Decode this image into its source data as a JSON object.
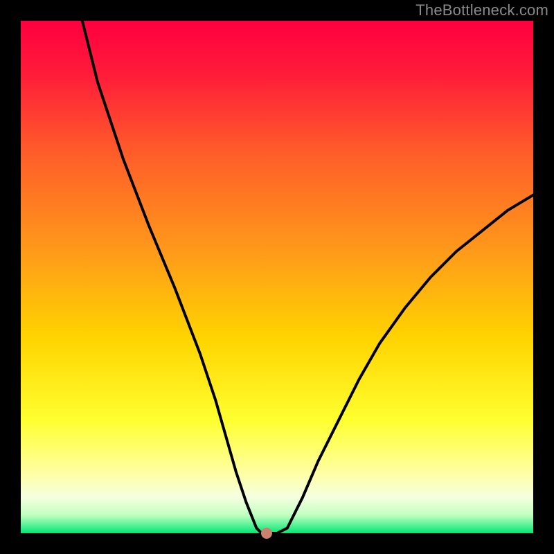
{
  "watermark": "TheBottleneck.com",
  "colors": {
    "frame_bg": "#000000",
    "watermark": "#8a8a8a",
    "curve": "#000000",
    "marker": "#cc8070",
    "gradient_stops": [
      {
        "offset": 0.0,
        "color": "#ff0040"
      },
      {
        "offset": 0.1,
        "color": "#ff1a3a"
      },
      {
        "offset": 0.25,
        "color": "#ff5a2a"
      },
      {
        "offset": 0.45,
        "color": "#ff9a1a"
      },
      {
        "offset": 0.62,
        "color": "#ffd400"
      },
      {
        "offset": 0.78,
        "color": "#ffff30"
      },
      {
        "offset": 0.88,
        "color": "#ffffa0"
      },
      {
        "offset": 0.93,
        "color": "#f5ffe0"
      },
      {
        "offset": 0.965,
        "color": "#c0ffc0"
      },
      {
        "offset": 1.0,
        "color": "#00e874"
      }
    ]
  },
  "chart_data": {
    "type": "line",
    "title": "",
    "xlabel": "",
    "ylabel": "",
    "xlim": [
      0,
      100
    ],
    "ylim": [
      0,
      100
    ],
    "grid": false,
    "legend": false,
    "series": [
      {
        "name": "curve",
        "x": [
          12,
          15,
          20,
          25,
          30,
          35,
          38,
          40,
          42,
          44,
          46,
          47,
          48,
          50,
          52,
          55,
          58,
          62,
          66,
          70,
          75,
          80,
          85,
          90,
          95,
          100
        ],
        "y": [
          100,
          88,
          73,
          60,
          48,
          35,
          26,
          19,
          12,
          6,
          1,
          0,
          0,
          0,
          1,
          7,
          14,
          22,
          30,
          37,
          44,
          50,
          55,
          59,
          63,
          66
        ]
      }
    ],
    "annotations": [
      {
        "name": "marker-dot",
        "x": 48,
        "y": 0,
        "color": "#cc8070"
      }
    ]
  }
}
